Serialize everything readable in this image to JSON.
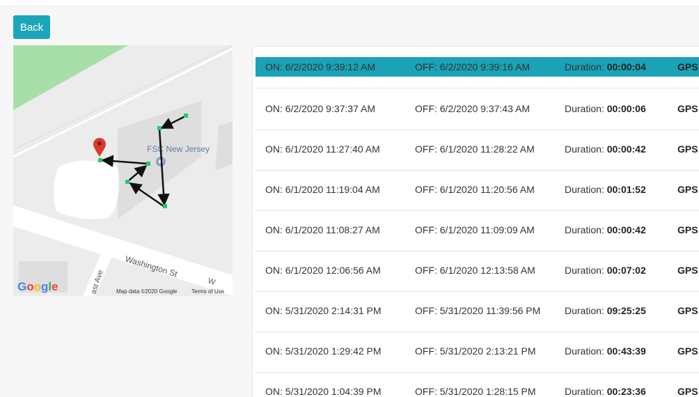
{
  "toolbar": {
    "back_label": "Back"
  },
  "map": {
    "place_label": "FSC New Jersey",
    "street_label": "Washington St",
    "street_label_2": "ast Ave",
    "street_label_3": "W",
    "google_logo": [
      "G",
      "o",
      "o",
      "g",
      "l",
      "e"
    ],
    "google_colors": [
      "#4285F4",
      "#EA4335",
      "#FBBC05",
      "#4285F4",
      "#34A853",
      "#EA4335"
    ],
    "map_data": "Map data ©2020 Google",
    "terms": "Terms of Use"
  },
  "events": [
    {
      "on": "ON: 6/2/2020 9:39:12 AM",
      "off": "OFF: 6/2/2020 9:39:16 AM",
      "dur_label": "Duration:",
      "dur": "00:00:04",
      "src": "GPS",
      "selected": true
    },
    {
      "on": "ON: 6/2/2020 9:37:37 AM",
      "off": "OFF: 6/2/2020 9:37:43 AM",
      "dur_label": "Duration:",
      "dur": "00:00:06",
      "src": "GPS"
    },
    {
      "on": "ON: 6/1/2020 11:27:40 AM",
      "off": "OFF: 6/1/2020 11:28:22 AM",
      "dur_label": "Duration:",
      "dur": "00:00:42",
      "src": "GPS"
    },
    {
      "on": "ON: 6/1/2020 11:19:04 AM",
      "off": "OFF: 6/1/2020 11:20:56 AM",
      "dur_label": "Duration:",
      "dur": "00:01:52",
      "src": "GPS"
    },
    {
      "on": "ON: 6/1/2020 11:08:27 AM",
      "off": "OFF: 6/1/2020 11:09:09 AM",
      "dur_label": "Duration:",
      "dur": "00:00:42",
      "src": "GPS"
    },
    {
      "on": "ON: 6/1/2020 12:06:56 AM",
      "off": "OFF: 6/1/2020 12:13:58 AM",
      "dur_label": "Duration:",
      "dur": "00:07:02",
      "src": "GPS"
    },
    {
      "on": "ON: 5/31/2020 2:14:31 PM",
      "off": "OFF: 5/31/2020 11:39:56 PM",
      "dur_label": "Duration:",
      "dur": "09:25:25",
      "src": "GPS"
    },
    {
      "on": "ON: 5/31/2020 1:29:42 PM",
      "off": "OFF: 5/31/2020 2:13:21 PM",
      "dur_label": "Duration:",
      "dur": "00:43:39",
      "src": "GPS"
    },
    {
      "on": "ON: 5/31/2020 1:04:39 PM",
      "off": "OFF: 5/31/2020 1:28:15 PM",
      "dur_label": "Duration:",
      "dur": "00:23:36",
      "src": "GPS"
    }
  ],
  "colors": {
    "accent": "#1da6b8",
    "selected_row": "#1aa2b6",
    "route_point": "#22cc66",
    "pin": "#d93a2b"
  }
}
